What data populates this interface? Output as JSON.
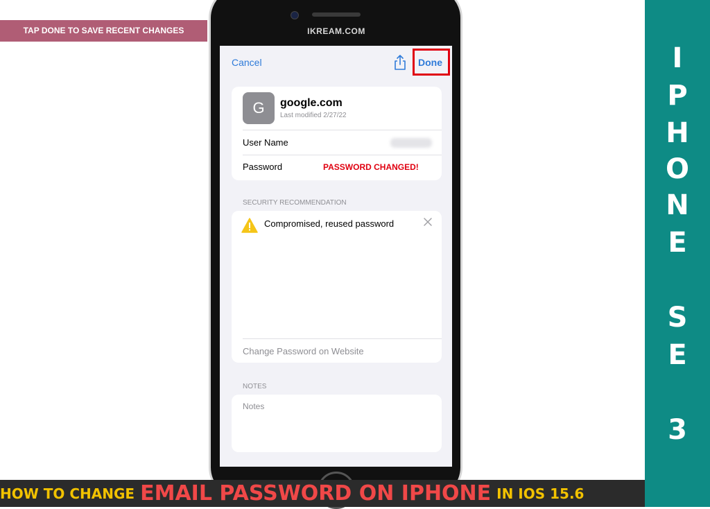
{
  "overlay": {
    "tag": "TAP DONE TO SAVE RECENT CHANGES",
    "sidebar_letters": [
      "I",
      "P",
      "H",
      "O",
      "N",
      "E",
      "S",
      "E",
      "3"
    ],
    "bottom": {
      "part1": "HOW TO CHANGE",
      "part2": "EMAIL PASSWORD ON IPHONE",
      "part3": "IN IOS 15.6"
    }
  },
  "device": {
    "brand": "IKREAM.COM"
  },
  "nav": {
    "cancel": "Cancel",
    "done": "Done",
    "share_icon": "share-icon"
  },
  "account": {
    "avatar_letter": "G",
    "site": "google.com",
    "modified": "Last modified 2/27/22",
    "username_label": "User Name",
    "password_label": "Password",
    "password_status": "PASSWORD CHANGED!"
  },
  "security": {
    "section_title": "SECURITY RECOMMENDATION",
    "warning": "Compromised, reused password",
    "change_link": "Change Password on Website"
  },
  "notes": {
    "section_title": "NOTES",
    "placeholder": "Notes"
  },
  "colors": {
    "accent": "#2f7bd9",
    "alert": "#e00010",
    "sidebar": "#0e8b85",
    "tag": "#b05d75"
  }
}
